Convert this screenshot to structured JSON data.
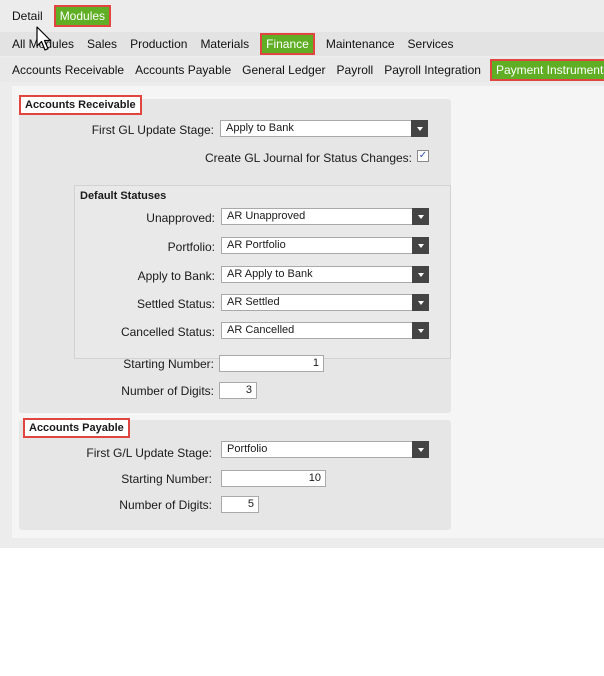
{
  "tabs_row1": [
    "Detail",
    "Modules"
  ],
  "tabs_row2": [
    "All Modules",
    "Sales",
    "Production",
    "Materials",
    "Finance",
    "Maintenance",
    "Services"
  ],
  "tabs_row3": [
    "Accounts Receivable",
    "Accounts Payable",
    "General Ledger",
    "Payroll",
    "Payroll Integration",
    "Payment Instruments"
  ],
  "ar": {
    "title": "Accounts Receivable",
    "first_gl_label": "First GL Update Stage:",
    "first_gl_value": "Apply to Bank",
    "create_gl_label": "Create GL Journal for Status Changes:",
    "create_gl_checked": "✓",
    "default_statuses_title": "Default Statuses",
    "statuses": [
      {
        "label": "Unapproved:",
        "value": "AR Unapproved"
      },
      {
        "label": "Portfolio:",
        "value": "AR Portfolio"
      },
      {
        "label": "Apply to Bank:",
        "value": "AR Apply to Bank"
      },
      {
        "label": "Settled Status:",
        "value": "AR Settled"
      },
      {
        "label": "Cancelled Status:",
        "value": "AR Cancelled"
      }
    ],
    "starting_number_label": "Starting Number:",
    "starting_number_value": "1",
    "digits_label": "Number of Digits:",
    "digits_value": "3"
  },
  "ap": {
    "title": "Accounts Payable",
    "first_gl_label": "First G/L Update Stage:",
    "first_gl_value": "Portfolio",
    "starting_number_label": "Starting Number:",
    "starting_number_value": "10",
    "digits_label": "Number of Digits:",
    "digits_value": "5"
  }
}
